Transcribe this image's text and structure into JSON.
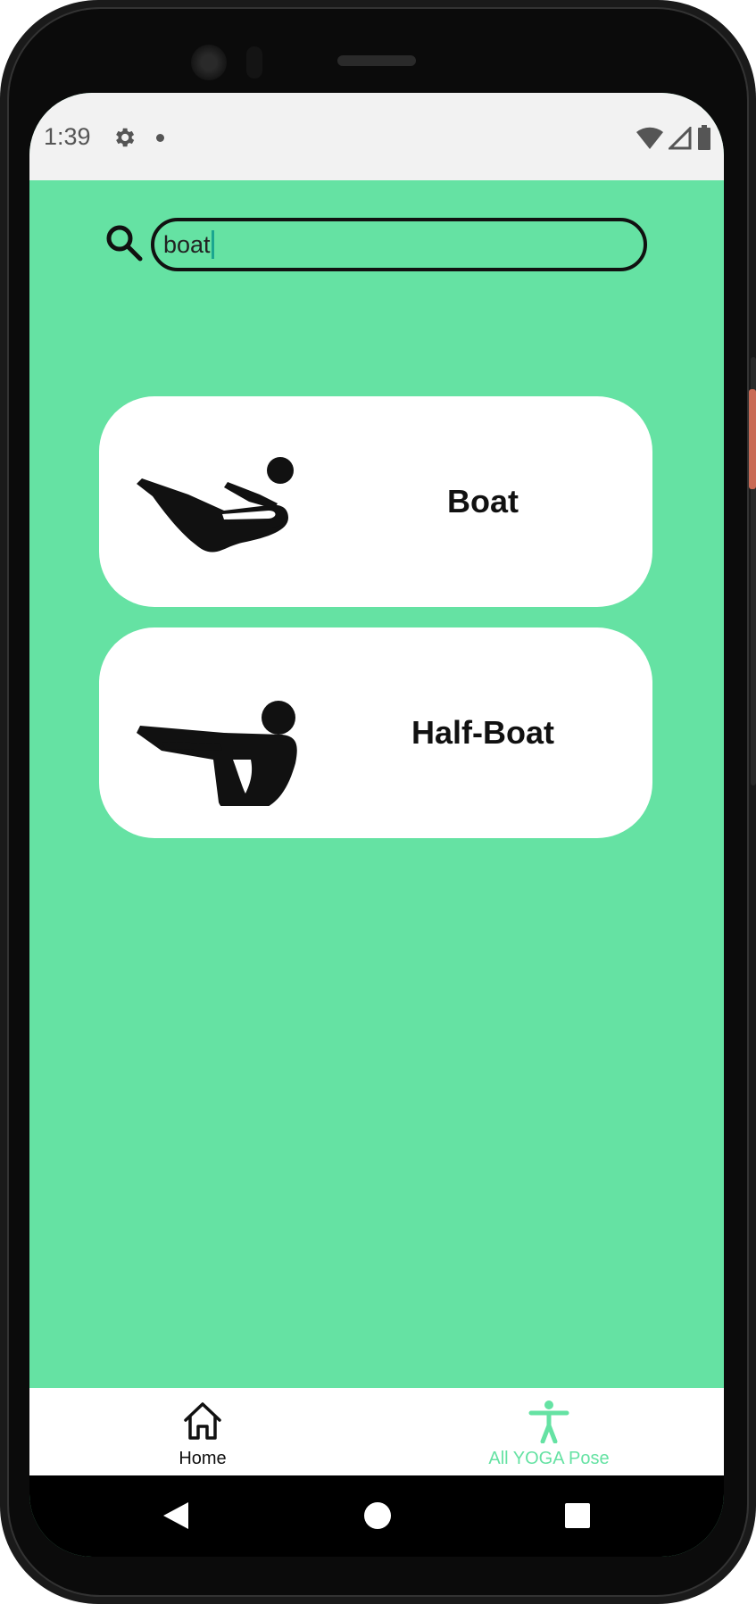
{
  "status_bar": {
    "time": "1:39"
  },
  "search": {
    "value": "boat"
  },
  "poses": [
    {
      "name": "Boat",
      "icon": "boat-pose-figure"
    },
    {
      "name": "Half-Boat",
      "icon": "half-boat-pose-figure"
    }
  ],
  "bottom_nav": {
    "home_label": "Home",
    "yoga_label": "All YOGA Pose",
    "active_color": "#65e2a3"
  },
  "colors": {
    "background": "#65e2a3",
    "card": "#ffffff"
  }
}
